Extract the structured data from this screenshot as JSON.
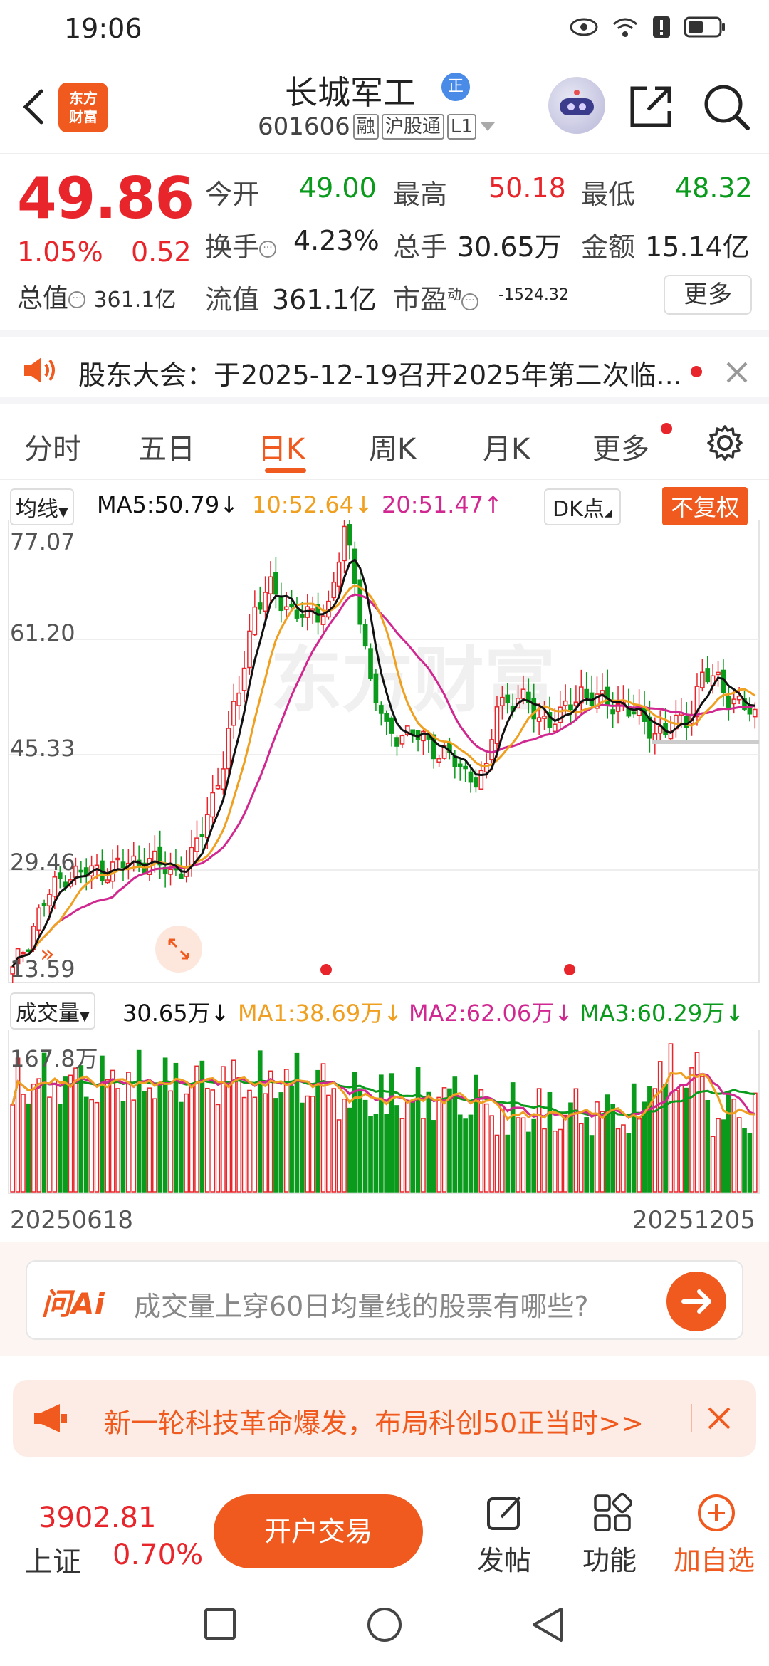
{
  "status_bar": {
    "time": "19:06"
  },
  "header": {
    "logo_line1": "东方",
    "logo_line2": "财富",
    "stock_name": "长城军工",
    "badge": "正",
    "stock_code": "601606",
    "tag_margin": "融",
    "tag_connect": "沪股通",
    "tag_level": "L1"
  },
  "quote": {
    "price": "49.86",
    "change_pct": "1.05%",
    "change_amt": "0.52",
    "open_label": "今开",
    "open_value": "49.00",
    "high_label": "最高",
    "high_value": "50.18",
    "low_label": "最低",
    "low_value": "48.32",
    "turnover_label": "换手",
    "turnover_value": "4.23%",
    "volume_label": "总手",
    "volume_value": "30.65万",
    "amount_label": "金额",
    "amount_value": "15.14亿",
    "mktcap_label": "总值",
    "mktcap_value": "361.1亿",
    "float_label": "流值",
    "float_value": "361.1亿",
    "pe_label": "市盈",
    "pe_sup": "动",
    "pe_value": "-1524.32",
    "more": "更多"
  },
  "notice": {
    "text": "股东大会：于2025-12-19召开2025年第二次临..."
  },
  "tabs": [
    "分时",
    "五日",
    "日K",
    "周K",
    "月K",
    "更多"
  ],
  "ma": {
    "selector": "均线",
    "ma5": "MA5:50.79↓",
    "ma10": "10:52.64↓",
    "ma20": "20:51.47↑",
    "dk": "DK点",
    "adjust": "不复权"
  },
  "y_axis": [
    "77.07",
    "61.20",
    "45.33",
    "29.46",
    "13.59"
  ],
  "volume": {
    "selector": "成交量",
    "vol": "30.65万↓",
    "ma1": "MA1:38.69万↓",
    "ma2": "MA2:62.06万↓",
    "ma3": "MA3:60.29万↓",
    "max_label": "167.8万"
  },
  "dates": {
    "start": "20250618",
    "end": "20251205"
  },
  "ai": {
    "brand": "问Ai",
    "prompt": "成交量上穿60日均量线的股票有哪些?"
  },
  "promo": {
    "text": "新一轮科技革命爆发，布局科创50正当时>>"
  },
  "bottom": {
    "index_value": "3902.81",
    "index_name": "上证",
    "index_pct": "0.70%",
    "trade_button": "开户交易",
    "post": "发帖",
    "func": "功能",
    "watch": "加自选"
  },
  "colors": {
    "up": "#e8252b",
    "down": "#0a9a1c",
    "accent": "#f05a1e",
    "ma5": "#111111",
    "ma10": "#f0a020",
    "ma20": "#d02890"
  }
}
